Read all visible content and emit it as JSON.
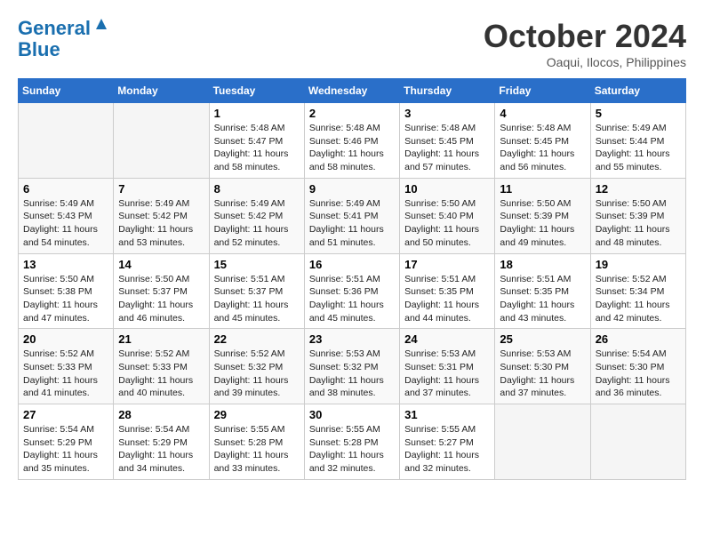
{
  "header": {
    "logo_line1": "General",
    "logo_line2": "Blue",
    "month": "October 2024",
    "location": "Oaqui, Ilocos, Philippines"
  },
  "weekdays": [
    "Sunday",
    "Monday",
    "Tuesday",
    "Wednesday",
    "Thursday",
    "Friday",
    "Saturday"
  ],
  "weeks": [
    [
      {
        "day": "",
        "info": ""
      },
      {
        "day": "",
        "info": ""
      },
      {
        "day": "1",
        "info": "Sunrise: 5:48 AM\nSunset: 5:47 PM\nDaylight: 11 hours and 58 minutes."
      },
      {
        "day": "2",
        "info": "Sunrise: 5:48 AM\nSunset: 5:46 PM\nDaylight: 11 hours and 58 minutes."
      },
      {
        "day": "3",
        "info": "Sunrise: 5:48 AM\nSunset: 5:45 PM\nDaylight: 11 hours and 57 minutes."
      },
      {
        "day": "4",
        "info": "Sunrise: 5:48 AM\nSunset: 5:45 PM\nDaylight: 11 hours and 56 minutes."
      },
      {
        "day": "5",
        "info": "Sunrise: 5:49 AM\nSunset: 5:44 PM\nDaylight: 11 hours and 55 minutes."
      }
    ],
    [
      {
        "day": "6",
        "info": "Sunrise: 5:49 AM\nSunset: 5:43 PM\nDaylight: 11 hours and 54 minutes."
      },
      {
        "day": "7",
        "info": "Sunrise: 5:49 AM\nSunset: 5:42 PM\nDaylight: 11 hours and 53 minutes."
      },
      {
        "day": "8",
        "info": "Sunrise: 5:49 AM\nSunset: 5:42 PM\nDaylight: 11 hours and 52 minutes."
      },
      {
        "day": "9",
        "info": "Sunrise: 5:49 AM\nSunset: 5:41 PM\nDaylight: 11 hours and 51 minutes."
      },
      {
        "day": "10",
        "info": "Sunrise: 5:50 AM\nSunset: 5:40 PM\nDaylight: 11 hours and 50 minutes."
      },
      {
        "day": "11",
        "info": "Sunrise: 5:50 AM\nSunset: 5:39 PM\nDaylight: 11 hours and 49 minutes."
      },
      {
        "day": "12",
        "info": "Sunrise: 5:50 AM\nSunset: 5:39 PM\nDaylight: 11 hours and 48 minutes."
      }
    ],
    [
      {
        "day": "13",
        "info": "Sunrise: 5:50 AM\nSunset: 5:38 PM\nDaylight: 11 hours and 47 minutes."
      },
      {
        "day": "14",
        "info": "Sunrise: 5:50 AM\nSunset: 5:37 PM\nDaylight: 11 hours and 46 minutes."
      },
      {
        "day": "15",
        "info": "Sunrise: 5:51 AM\nSunset: 5:37 PM\nDaylight: 11 hours and 45 minutes."
      },
      {
        "day": "16",
        "info": "Sunrise: 5:51 AM\nSunset: 5:36 PM\nDaylight: 11 hours and 45 minutes."
      },
      {
        "day": "17",
        "info": "Sunrise: 5:51 AM\nSunset: 5:35 PM\nDaylight: 11 hours and 44 minutes."
      },
      {
        "day": "18",
        "info": "Sunrise: 5:51 AM\nSunset: 5:35 PM\nDaylight: 11 hours and 43 minutes."
      },
      {
        "day": "19",
        "info": "Sunrise: 5:52 AM\nSunset: 5:34 PM\nDaylight: 11 hours and 42 minutes."
      }
    ],
    [
      {
        "day": "20",
        "info": "Sunrise: 5:52 AM\nSunset: 5:33 PM\nDaylight: 11 hours and 41 minutes."
      },
      {
        "day": "21",
        "info": "Sunrise: 5:52 AM\nSunset: 5:33 PM\nDaylight: 11 hours and 40 minutes."
      },
      {
        "day": "22",
        "info": "Sunrise: 5:52 AM\nSunset: 5:32 PM\nDaylight: 11 hours and 39 minutes."
      },
      {
        "day": "23",
        "info": "Sunrise: 5:53 AM\nSunset: 5:32 PM\nDaylight: 11 hours and 38 minutes."
      },
      {
        "day": "24",
        "info": "Sunrise: 5:53 AM\nSunset: 5:31 PM\nDaylight: 11 hours and 37 minutes."
      },
      {
        "day": "25",
        "info": "Sunrise: 5:53 AM\nSunset: 5:30 PM\nDaylight: 11 hours and 37 minutes."
      },
      {
        "day": "26",
        "info": "Sunrise: 5:54 AM\nSunset: 5:30 PM\nDaylight: 11 hours and 36 minutes."
      }
    ],
    [
      {
        "day": "27",
        "info": "Sunrise: 5:54 AM\nSunset: 5:29 PM\nDaylight: 11 hours and 35 minutes."
      },
      {
        "day": "28",
        "info": "Sunrise: 5:54 AM\nSunset: 5:29 PM\nDaylight: 11 hours and 34 minutes."
      },
      {
        "day": "29",
        "info": "Sunrise: 5:55 AM\nSunset: 5:28 PM\nDaylight: 11 hours and 33 minutes."
      },
      {
        "day": "30",
        "info": "Sunrise: 5:55 AM\nSunset: 5:28 PM\nDaylight: 11 hours and 32 minutes."
      },
      {
        "day": "31",
        "info": "Sunrise: 5:55 AM\nSunset: 5:27 PM\nDaylight: 11 hours and 32 minutes."
      },
      {
        "day": "",
        "info": ""
      },
      {
        "day": "",
        "info": ""
      }
    ]
  ]
}
